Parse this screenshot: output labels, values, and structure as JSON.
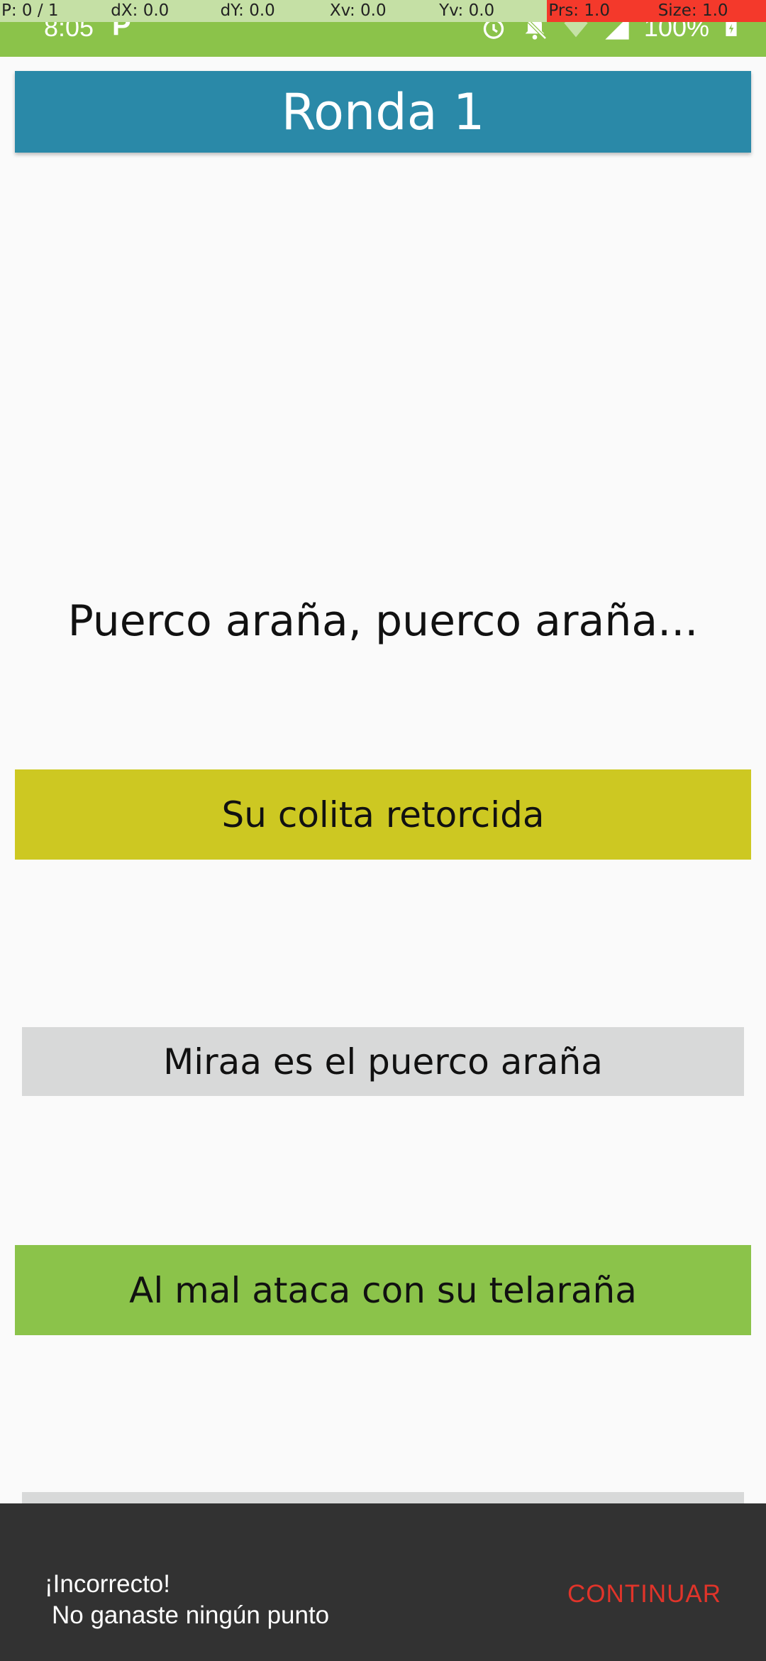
{
  "pointer_location": [
    "P: 0 / 1",
    "dX: 0.0",
    "dY: 0.0",
    "Xv: 0.0",
    "Yv: 0.0",
    "Prs: 1.0",
    "Size: 1.0"
  ],
  "status_bar": {
    "time": "8:05",
    "left_icon": "parking-app-icon",
    "icons": [
      "alarm-icon",
      "notifications-off-icon",
      "wifi-icon",
      "signal-icon",
      "battery-charging-icon"
    ],
    "battery": "100%"
  },
  "header": {
    "title": "Ronda 1"
  },
  "question": "Puerco araña, puerco araña...",
  "options": [
    "Su colita retorcida",
    "Miraa es el puerco araña",
    "Al mal ataca con su telaraña",
    ""
  ],
  "snackbar": {
    "line1": "¡Incorrecto!",
    "line2": "No ganaste ningún punto",
    "action": "CONTINUAR"
  },
  "colors": {
    "status_bar": "#8bc34a",
    "title_bar": "#2a89a8",
    "option_selected_yellow": "#cdc822",
    "option_correct_green": "#8bc34a",
    "option_default_gray": "#d8d9d9",
    "snackbar_bg": "#323232",
    "snackbar_action": "#e0342a"
  }
}
